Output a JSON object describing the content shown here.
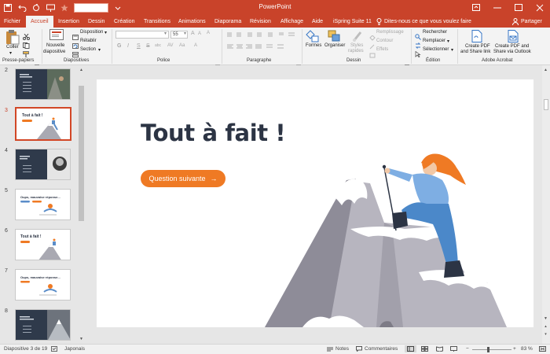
{
  "window": {
    "title": "PowerPoint"
  },
  "tabs": [
    "Fichier",
    "Accueil",
    "Insertion",
    "Dessin",
    "Création",
    "Transitions",
    "Animations",
    "Diaporama",
    "Révision",
    "Affichage",
    "Aide",
    "iSpring Suite 11"
  ],
  "active_tab": "Accueil",
  "tell_me": "Dites-nous ce que vous voulez faire",
  "share": "Partager",
  "ribbon": {
    "clipboard": {
      "paste": "Coller",
      "label": "Presse-papiers"
    },
    "slides": {
      "new_slide_1": "Nouvelle",
      "new_slide_2": "diapositive",
      "layout": "Disposition",
      "reset": "Rétablir",
      "section": "Section",
      "label": "Diapositives"
    },
    "font": {
      "size": "55",
      "label": "Police",
      "bold": "G",
      "italic": "I",
      "underline": "S",
      "strike": "S",
      "shadow": "abc"
    },
    "paragraph": {
      "label": "Paragraphe"
    },
    "drawing": {
      "shapes": "Formes",
      "arrange": "Organiser",
      "styles_1": "Styles",
      "styles_2": "rapides",
      "fill": "Remplissage",
      "outline": "Contour",
      "effects": "Effets",
      "label": "Dessin"
    },
    "editing": {
      "find": "Rechercher",
      "replace": "Remplacer",
      "select": "Sélectionner",
      "label": "Édition"
    },
    "acrobat": {
      "create_pdf_1": "Create PDF",
      "create_pdf_2": "and Share link",
      "create_pdf_outlook_1": "Create PDF and",
      "create_pdf_outlook_2": "Share via Outlook",
      "label": "Adobe Acrobat"
    }
  },
  "thumbnails": [
    {
      "number": "2",
      "style": "dark"
    },
    {
      "number": "3",
      "style": "summit",
      "selected": true,
      "title": "Tout à fait !"
    },
    {
      "number": "4",
      "style": "dark"
    },
    {
      "number": "5",
      "style": "oops",
      "title": "Oups, mauvaise réponse..."
    },
    {
      "number": "6",
      "style": "summit",
      "title": "Tout à fait !"
    },
    {
      "number": "7",
      "style": "oops",
      "title": "Oups, mauvaise réponse..."
    },
    {
      "number": "8",
      "style": "dark"
    }
  ],
  "slide": {
    "title": "Tout à fait !",
    "button": "Question suivante",
    "button_arrow": "→"
  },
  "status": {
    "slide_info": "Diapositive 3 de 19",
    "language": "Japonais",
    "notes": "Notes",
    "comments": "Commentaires",
    "zoom": "83 %"
  },
  "colors": {
    "accent": "#c9432a",
    "orange": "#ef7a24",
    "title_text": "#2c3444"
  }
}
